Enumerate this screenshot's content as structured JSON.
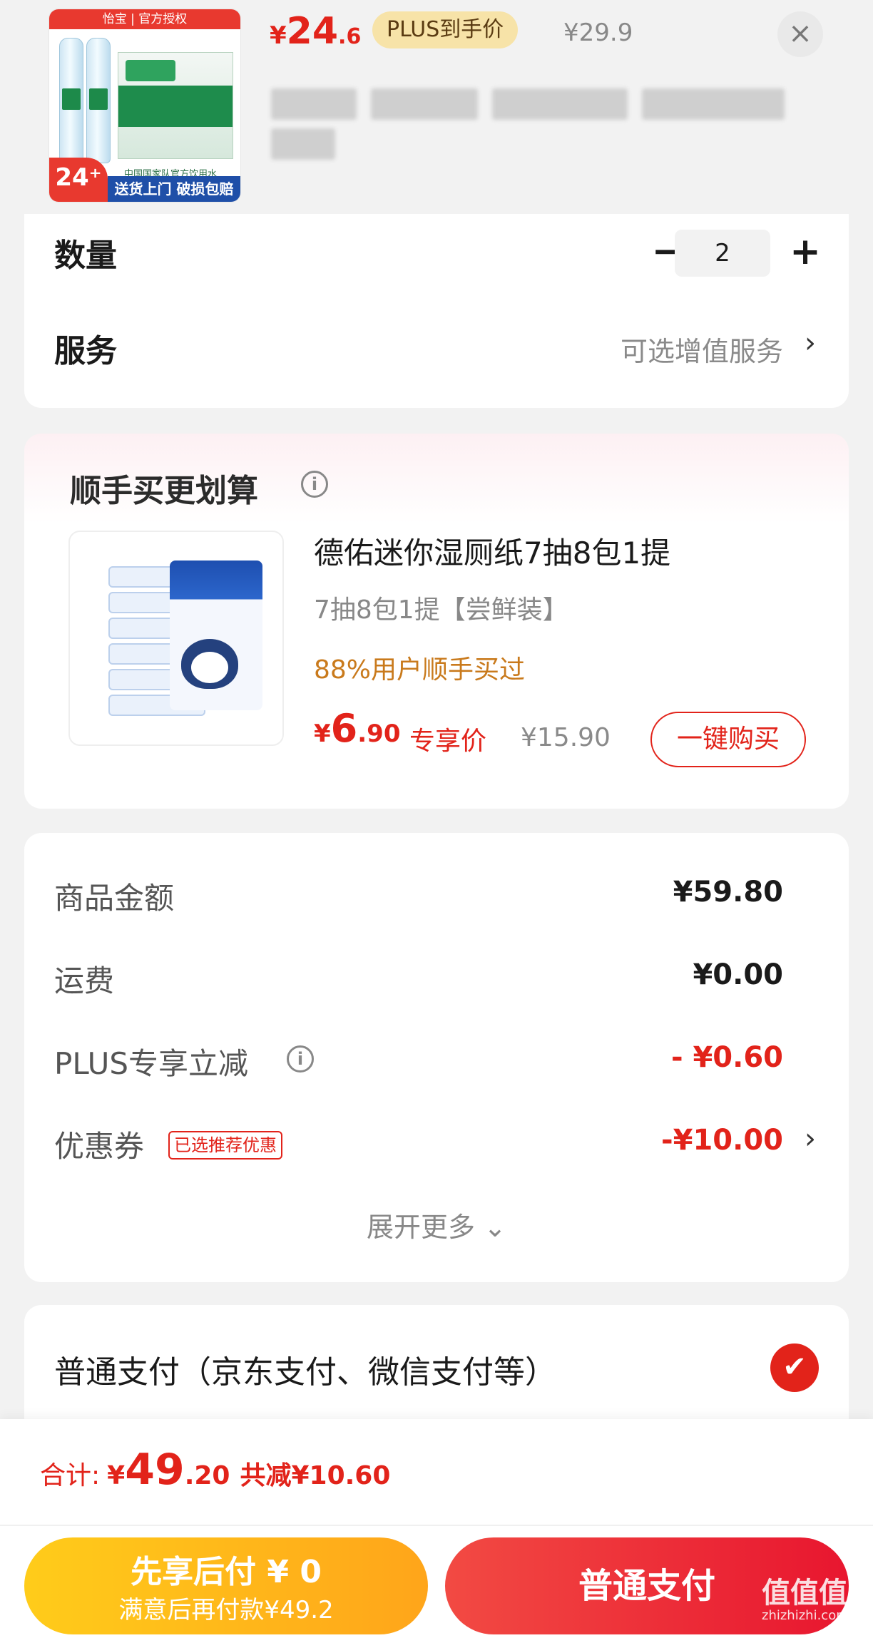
{
  "header": {
    "product_image": {
      "brand_bar": "怡宝 | 官方授权",
      "count": "24⁺",
      "tagline": "中国国家队官方饮用水",
      "promo": "送货上门 破损包赔"
    },
    "price_currency": "¥",
    "price_int": "24",
    "price_dec": ".6",
    "plus_badge": "PLUS到手价",
    "orig_price": "¥29.9",
    "close_icon": "close-icon"
  },
  "order": {
    "qty_label": "数量",
    "qty_value": "2",
    "minus_icon": "minus-icon",
    "plus_icon": "plus-icon",
    "service_label": "服务",
    "service_hint": "可选增值服务",
    "chevron": "›"
  },
  "addon": {
    "title": "顺手买更划算",
    "info_icon": "i",
    "item": {
      "name": "德佑迷你湿厕纸7抽8包1提",
      "spec": "7抽8包1提【尝鲜装】",
      "hot": "88%用户顺手买过",
      "price_currency": "¥",
      "price_int": "6",
      "price_dec": ".90",
      "exclusive": "专享价",
      "orig_price": "¥15.90",
      "buy_button": "一键购买"
    }
  },
  "fees": {
    "rows": [
      {
        "label": "商品金额",
        "value": "¥59.80"
      },
      {
        "label": "运费",
        "value": "¥0.00"
      },
      {
        "label": "PLUS专享立减",
        "value": "- ¥0.60"
      },
      {
        "label": "优惠券",
        "value": "-¥10.00"
      }
    ],
    "coupon_tag": "已选推荐优惠",
    "expand": "展开更多 ⌄"
  },
  "payment": {
    "method_label": "普通支付（京东支付、微信支付等）",
    "check_icon": "✔"
  },
  "footer": {
    "total_label": "合计:",
    "total_currency": "¥",
    "total_int": "49",
    "total_dec": ".20",
    "total_saved": "共减¥10.60",
    "later_line1": "先享后付 ¥ 0",
    "later_line2": "满意后再付款¥49.2",
    "normal_button": "普通支付"
  },
  "watermark": {
    "text": "值值值",
    "url": "zhizhizhi.com"
  },
  "colors": {
    "accent_red": "#e2231a",
    "plus_gold": "#f7e3a8",
    "later_yellow": "#ffb81a"
  }
}
